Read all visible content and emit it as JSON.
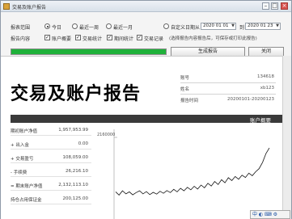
{
  "window": {
    "title": "交易及账户报告",
    "controls": {
      "minimize": "–",
      "maximize": "□",
      "close": "×"
    }
  },
  "toolbar": {
    "period_label": "报表范围",
    "period_options": [
      {
        "label": "今日",
        "selected": true
      },
      {
        "label": "最近一周",
        "selected": false
      },
      {
        "label": "最近一月",
        "selected": false
      }
    ],
    "custom_range_label": "自定义日期",
    "custom_range_selected": false,
    "date_from_label": "从",
    "date_from": "2020 01 01",
    "date_to_label": "到",
    "date_to": "2020 01 23",
    "content_label": "报告内容",
    "content_options": [
      {
        "label": "账户概要",
        "checked": true
      },
      {
        "label": "交易统计",
        "checked": true
      },
      {
        "label": "期间统计",
        "checked": true
      },
      {
        "label": "交易记录",
        "checked": true
      }
    ],
    "note": "(选择报告内容报告后，可保存或打印此报告)",
    "progress": 1.0,
    "generate_label": "生成报告",
    "close_label": "关闭"
  },
  "report": {
    "title": "交易及账户报告",
    "info": [
      {
        "key": "账号",
        "value": "134618"
      },
      {
        "key": "姓名",
        "value": "xb123"
      },
      {
        "key": "报告时间",
        "value": "20200101-20200123"
      }
    ],
    "section_title": "账户概要",
    "stats": [
      {
        "label": "期初账户净值",
        "value": "1,957,953.99"
      },
      {
        "label": "+ 出入金",
        "value": "0.00"
      },
      {
        "label": "+ 交易盈亏",
        "value": "108,059.00"
      },
      {
        "label": "- 手续费",
        "value": "26,216.10"
      },
      {
        "label": "= 期末账户净值",
        "value": "2,132,113.10"
      },
      {
        "label": "持仓占用保证金",
        "value": "200,125.00"
      }
    ]
  },
  "chart_data": {
    "type": "line",
    "title": "",
    "xlabel": "",
    "ylabel": "",
    "y_tick_label": "2160000",
    "ylim": [
      1850000,
      2200000
    ],
    "colors": {
      "line": "#111111"
    },
    "series": [
      {
        "values": [
          1957953,
          1945000,
          1962000,
          1950000,
          1958000,
          1946000,
          1955000,
          1962000,
          1950000,
          1959000,
          1947000,
          1956000,
          1949000,
          1960000,
          1952000,
          1963000,
          1955000,
          1968000,
          1958000,
          1972000,
          1962000,
          1976000,
          1966000,
          1980000,
          1969000,
          1985000,
          1974000,
          1992000,
          1981000,
          1999000,
          1987000,
          2006000,
          1994000,
          2014000,
          2003000,
          2019000,
          2008000,
          2024000,
          2015000,
          2032000,
          2022000,
          2038000,
          2050000,
          2075000,
          2110000,
          2132113
        ]
      }
    ]
  },
  "ime": {
    "label": "中 ◐ ⌨ ⚙"
  }
}
